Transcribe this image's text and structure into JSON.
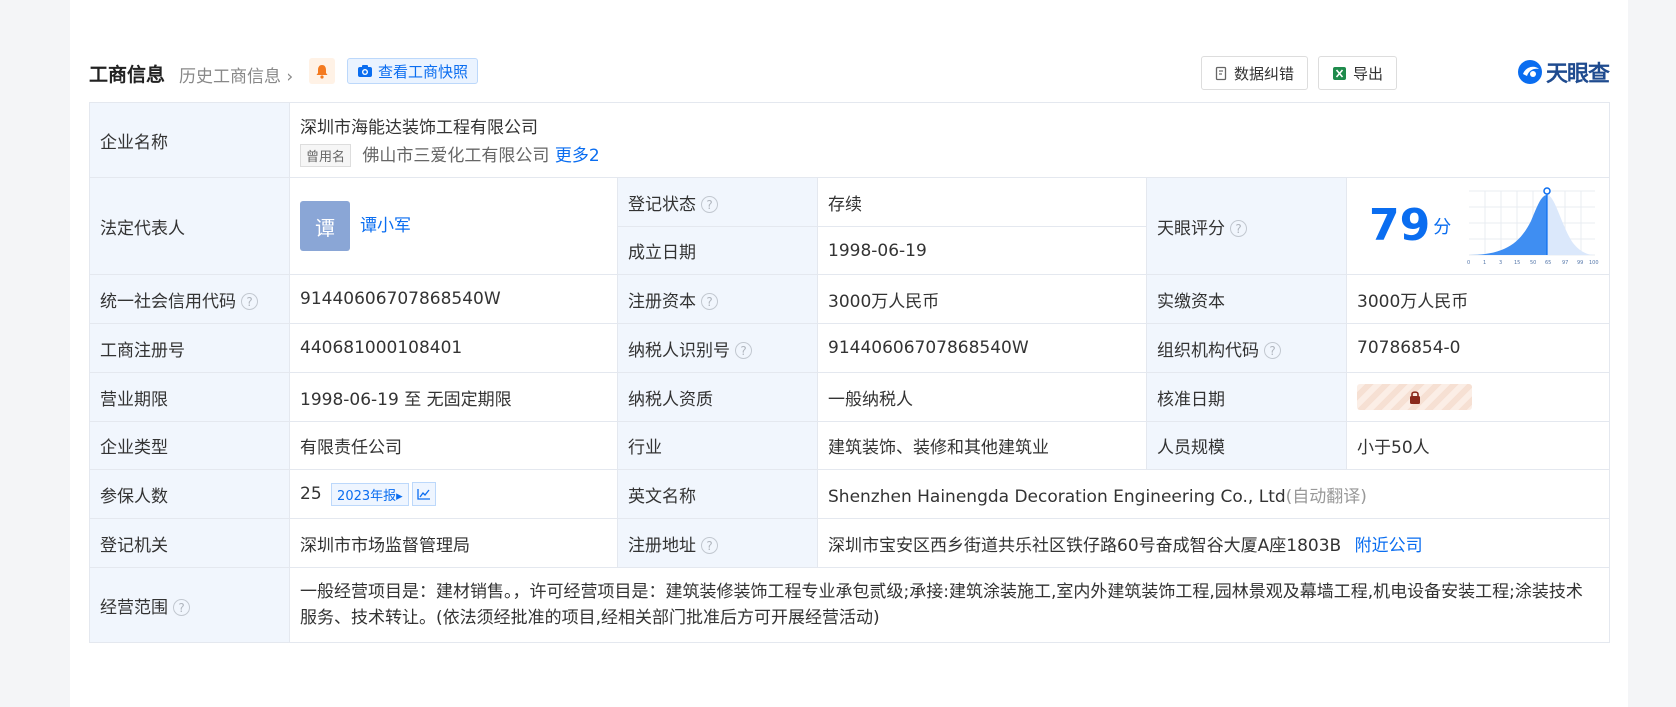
{
  "header": {
    "title": "工商信息",
    "history": "历史工商信息",
    "snapshot": "查看工商快照",
    "correct": "数据纠错",
    "export": "导出",
    "logo": "天眼查"
  },
  "company": {
    "name_label": "企业名称",
    "name": "深圳市海能达装饰工程有限公司",
    "former_tag": "曾用名",
    "former_name": "佛山市三爱化工有限公司",
    "more": "更多2"
  },
  "legal": {
    "label": "法定代表人",
    "avatar": "谭",
    "name": "谭小军",
    "status_label": "登记状态",
    "status": "存续",
    "date_label": "成立日期",
    "date": "1998-06-19",
    "score_label": "天眼评分",
    "score": "79",
    "score_unit": "分"
  },
  "score_chart": {
    "ticks": [
      "0",
      "1",
      "3",
      "15",
      "50",
      "65",
      "97",
      "99",
      "100"
    ]
  },
  "rows": {
    "credit_code_label": "统一社会信用代码",
    "credit_code": "91440606707868540W",
    "reg_capital_label": "注册资本",
    "reg_capital": "3000万人民币",
    "paid_capital_label": "实缴资本",
    "paid_capital": "3000万人民币",
    "reg_no_label": "工商注册号",
    "reg_no": "440681000108401",
    "taxpayer_id_label": "纳税人识别号",
    "taxpayer_id": "91440606707868540W",
    "org_code_label": "组织机构代码",
    "org_code": "70786854-0",
    "term_label": "营业期限",
    "term": "1998-06-19 至 无固定期限",
    "tax_qual_label": "纳税人资质",
    "tax_qual": "一般纳税人",
    "approve_label": "核准日期",
    "type_label": "企业类型",
    "type": "有限责任公司",
    "industry_label": "行业",
    "industry": "建筑装饰、装修和其他建筑业",
    "staff_label": "人员规模",
    "staff": "小于50人",
    "insured_label": "参保人数",
    "insured": "25",
    "insured_year": "2023年报",
    "en_name_label": "英文名称",
    "en_name": "Shenzhen Hainengda Decoration Engineering Co., Ltd",
    "en_auto": "(自动翻译)",
    "authority_label": "登记机关",
    "authority": "深圳市市场监督管理局",
    "address_label": "注册地址",
    "address": "深圳市宝安区西乡街道共乐社区铁仔路60号奋成智谷大厦A座1803B",
    "nearby": "附近公司",
    "scope_label": "经营范围",
    "scope": "一般经营项目是：建材销售。，许可经营项目是：建筑装修装饰工程专业承包贰级;承接:建筑涂装施工,室内外建筑装饰工程,园林景观及幕墙工程,机电设备安装工程;涂装技术服务、技术转让。(依法须经批准的项目,经相关部门批准后方可开展经营活动)"
  },
  "colors": {
    "accent": "#0a6df0",
    "label_bg": "#f1f6fd",
    "status_green": "#16a34a"
  }
}
